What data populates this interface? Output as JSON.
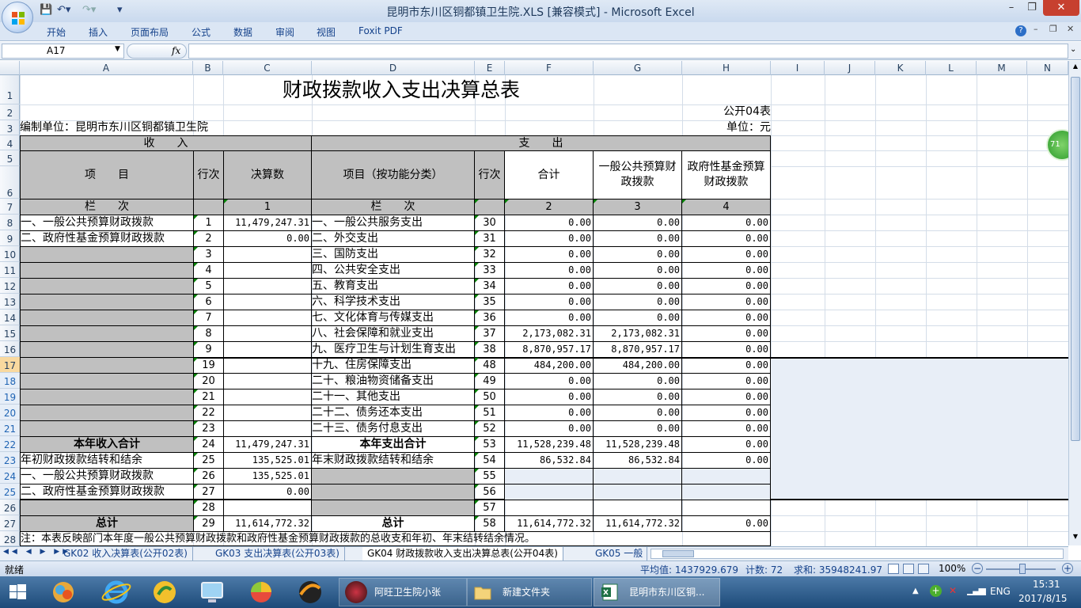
{
  "window": {
    "title": "昆明市东川区铜都镇卫生院.XLS  [兼容模式] - Microsoft Excel",
    "min": "–",
    "restore": "❐",
    "close": "✕"
  },
  "ribbon": {
    "tabs": [
      "开始",
      "插入",
      "页面布局",
      "公式",
      "数据",
      "审阅",
      "视图",
      "Foxit PDF"
    ]
  },
  "formula": {
    "namebox": "A17",
    "fx": "fx",
    "value": ""
  },
  "columns": [
    "A",
    "B",
    "C",
    "D",
    "E",
    "F",
    "G",
    "H",
    "I",
    "J",
    "K",
    "L",
    "M",
    "N"
  ],
  "rows": [
    "1",
    "2",
    "3",
    "4",
    "5",
    "6",
    "7",
    "8",
    "9",
    "10",
    "11",
    "12",
    "13",
    "14",
    "15",
    "16",
    "17",
    "18",
    "19",
    "20",
    "21",
    "22",
    "23",
    "24",
    "25",
    "26",
    "27",
    "28"
  ],
  "sheet": {
    "title": "财政拨款收入支出决算总表",
    "form_no": "公开04表",
    "unit_left": "编制单位：昆明市东川区铜都镇卫生院",
    "unit_right": "单位：元",
    "income_header": "收　　入",
    "expense_header": "支　　出",
    "h_item": "项　　目",
    "h_line": "行次",
    "h_amount": "决算数",
    "h_func": "项目（按功能分类）",
    "h_line2": "行次",
    "h_total": "合计",
    "h_general": "一般公共预算财政拨款",
    "h_fund": "政府性基金预算财政拨款",
    "r7_a": "栏　　次",
    "r7_c": "1",
    "r7_d": "栏　　次",
    "r7_f": "2",
    "r7_g": "3",
    "r7_h": "4",
    "note": "注：本表反映部门本年度一般公共预算财政拨款和政府性基金预算财政拨款的总收支和年初、年末结转结余情况。"
  },
  "table_rows": [
    {
      "row": "8",
      "a": "一、一般公共预算财政拨款",
      "b": "1",
      "c": "11,479,247.31",
      "d": "一、一般公共服务支出",
      "e": "30",
      "f": "0.00",
      "g": "0.00",
      "h": "0.00"
    },
    {
      "row": "9",
      "a": "二、政府性基金预算财政拨款",
      "b": "2",
      "c": "0.00",
      "d": "二、外交支出",
      "e": "31",
      "f": "0.00",
      "g": "0.00",
      "h": "0.00"
    },
    {
      "row": "10",
      "a": "",
      "b": "3",
      "c": "",
      "d": "三、国防支出",
      "e": "32",
      "f": "0.00",
      "g": "0.00",
      "h": "0.00"
    },
    {
      "row": "11",
      "a": "",
      "b": "4",
      "c": "",
      "d": "四、公共安全支出",
      "e": "33",
      "f": "0.00",
      "g": "0.00",
      "h": "0.00"
    },
    {
      "row": "12",
      "a": "",
      "b": "5",
      "c": "",
      "d": "五、教育支出",
      "e": "34",
      "f": "0.00",
      "g": "0.00",
      "h": "0.00"
    },
    {
      "row": "13",
      "a": "",
      "b": "6",
      "c": "",
      "d": "六、科学技术支出",
      "e": "35",
      "f": "0.00",
      "g": "0.00",
      "h": "0.00"
    },
    {
      "row": "14",
      "a": "",
      "b": "7",
      "c": "",
      "d": "七、文化体育与传媒支出",
      "e": "36",
      "f": "0.00",
      "g": "0.00",
      "h": "0.00"
    },
    {
      "row": "15",
      "a": "",
      "b": "8",
      "c": "",
      "d": "八、社会保障和就业支出",
      "e": "37",
      "f": "2,173,082.31",
      "g": "2,173,082.31",
      "h": "0.00"
    },
    {
      "row": "16",
      "a": "",
      "b": "9",
      "c": "",
      "d": "九、医疗卫生与计划生育支出",
      "e": "38",
      "f": "8,870,957.17",
      "g": "8,870,957.17",
      "h": "0.00"
    },
    {
      "row": "17",
      "a": "",
      "b": "19",
      "c": "",
      "d": "十九、住房保障支出",
      "e": "48",
      "f": "484,200.00",
      "g": "484,200.00",
      "h": "0.00"
    },
    {
      "row": "18",
      "a": "",
      "b": "20",
      "c": "",
      "d": "二十、粮油物资储备支出",
      "e": "49",
      "f": "0.00",
      "g": "0.00",
      "h": "0.00"
    },
    {
      "row": "19",
      "a": "",
      "b": "21",
      "c": "",
      "d": "二十一、其他支出",
      "e": "50",
      "f": "0.00",
      "g": "0.00",
      "h": "0.00"
    },
    {
      "row": "20",
      "a": "",
      "b": "22",
      "c": "",
      "d": "二十二、债务还本支出",
      "e": "51",
      "f": "0.00",
      "g": "0.00",
      "h": "0.00"
    },
    {
      "row": "21",
      "a": "",
      "b": "23",
      "c": "",
      "d": "二十三、债务付息支出",
      "e": "52",
      "f": "0.00",
      "g": "0.00",
      "h": "0.00"
    },
    {
      "row": "22",
      "a": "本年收入合计",
      "b": "24",
      "c": "11,479,247.31",
      "d": "本年支出合计",
      "e": "53",
      "f": "11,528,239.48",
      "g": "11,528,239.48",
      "h": "0.00",
      "bold": true
    },
    {
      "row": "23",
      "a": "年初财政拨款结转和结余",
      "b": "25",
      "c": "135,525.01",
      "d": "年末财政拨款结转和结余",
      "e": "54",
      "f": "86,532.84",
      "g": "86,532.84",
      "h": "0.00"
    },
    {
      "row": "24",
      "a": "一、一般公共预算财政拨款",
      "b": "26",
      "c": "135,525.01",
      "d": "",
      "e": "55",
      "f": "",
      "g": "",
      "h": ""
    },
    {
      "row": "25",
      "a": "二、政府性基金预算财政拨款",
      "b": "27",
      "c": "0.00",
      "d": "",
      "e": "56",
      "f": "",
      "g": "",
      "h": ""
    },
    {
      "row": "26",
      "a": "",
      "b": "28",
      "c": "",
      "d": "",
      "e": "57",
      "f": "",
      "g": "",
      "h": ""
    },
    {
      "row": "27",
      "a": "总计",
      "b": "29",
      "c": "11,614,772.32",
      "d": "总计",
      "e": "58",
      "f": "11,614,772.32",
      "g": "11,614,772.32",
      "h": "0.00",
      "bold": true
    }
  ],
  "sheet_tabs": [
    "GK02 收入决算表(公开02表)",
    "GK03 支出决算表(公开03表)",
    "GK04 财政拨款收入支出决算总表(公开04表)",
    "GK05 一般"
  ],
  "status": {
    "mode": "就绪",
    "average": "平均值: 1437929.679",
    "count": "计数: 72",
    "sum": "求和: 35948241.97",
    "zoom": "100%"
  },
  "taskbar": {
    "tasks": [
      "阿旺卫生院小张",
      "新建文件夹",
      "昆明市东川区铜..."
    ],
    "lang": "ENG",
    "time": "15:31",
    "date": "2017/8/15"
  },
  "side_badge": "71",
  "colors": {
    "accent": "#15428b",
    "gray_cell": "#c0c0c0",
    "selected_header": "#f9d99f"
  }
}
